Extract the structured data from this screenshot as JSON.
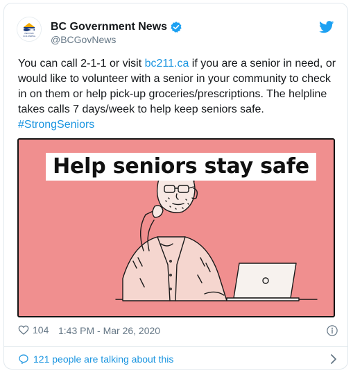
{
  "author": {
    "name": "BC Government News",
    "handle": "@BCGovNews",
    "avatar_icon": "bc-government-logo",
    "avatar_text_line1": "BRITISH",
    "avatar_text_line2": "COLUMBIA"
  },
  "tweet": {
    "text_before_link": "You can call 2-1-1 or visit ",
    "link_text": "bc211.ca",
    "text_after_link": " if you are a senior in need, or would like to volunteer with a senior in your community to check in on them or help pick-up groceries/prescriptions. The helpline takes calls 7 days/week to help keep seniors safe. ",
    "hashtag": "#StrongSeniors"
  },
  "media": {
    "title": "Help seniors stay safe",
    "background_color": "#f08f8f"
  },
  "meta": {
    "like_count": "104",
    "timestamp": "1:43 PM - Mar 26, 2020"
  },
  "discussion": {
    "label": "121 people are talking about this"
  },
  "icons": {
    "verified": "verified-badge-icon",
    "brand": "twitter-bird-icon",
    "like": "heart-icon",
    "info": "info-icon",
    "discussion": "speech-bubble-icon",
    "chevron": "chevron-right-icon"
  },
  "colors": {
    "link": "#1b95e0",
    "muted": "#657786",
    "text": "#14171a",
    "border": "#e1e8ed"
  }
}
